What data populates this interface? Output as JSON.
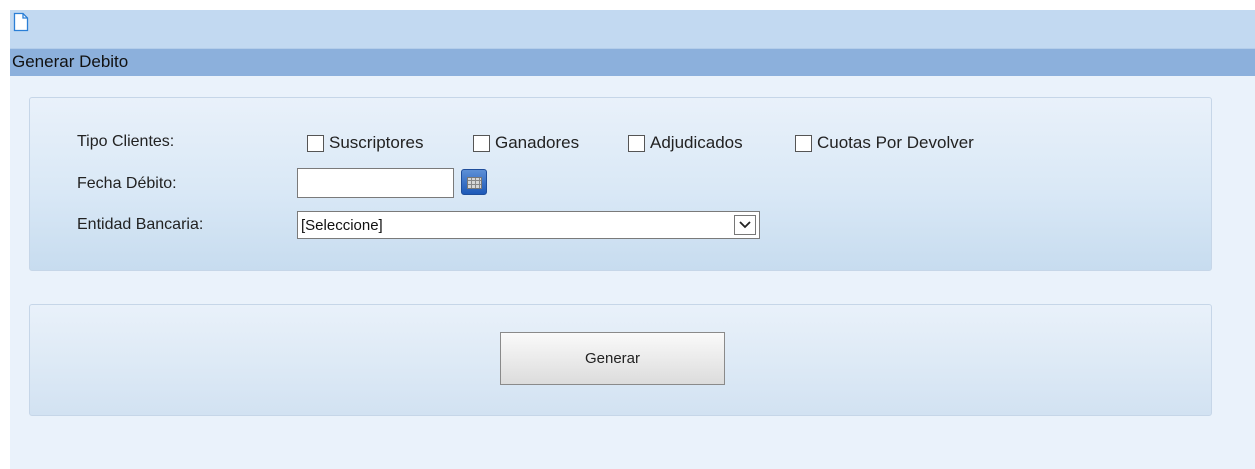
{
  "header": {
    "icon": "document-icon"
  },
  "title": "Generar Debito",
  "form": {
    "tipo_clientes_label": "Tipo Clientes:",
    "fecha_debito_label": "Fecha Débito:",
    "entidad_bancaria_label": "Entidad Bancaria:",
    "checkboxes": [
      {
        "label": "Suscriptores",
        "checked": false
      },
      {
        "label": "Ganadores",
        "checked": false
      },
      {
        "label": "Adjudicados",
        "checked": false
      },
      {
        "label": "Cuotas Por Devolver",
        "checked": false
      }
    ],
    "fecha_debito_value": "",
    "calendar_icon": "calendar-icon",
    "entidad_bancaria_selected": "[Seleccione]"
  },
  "actions": {
    "generar_label": "Generar"
  }
}
